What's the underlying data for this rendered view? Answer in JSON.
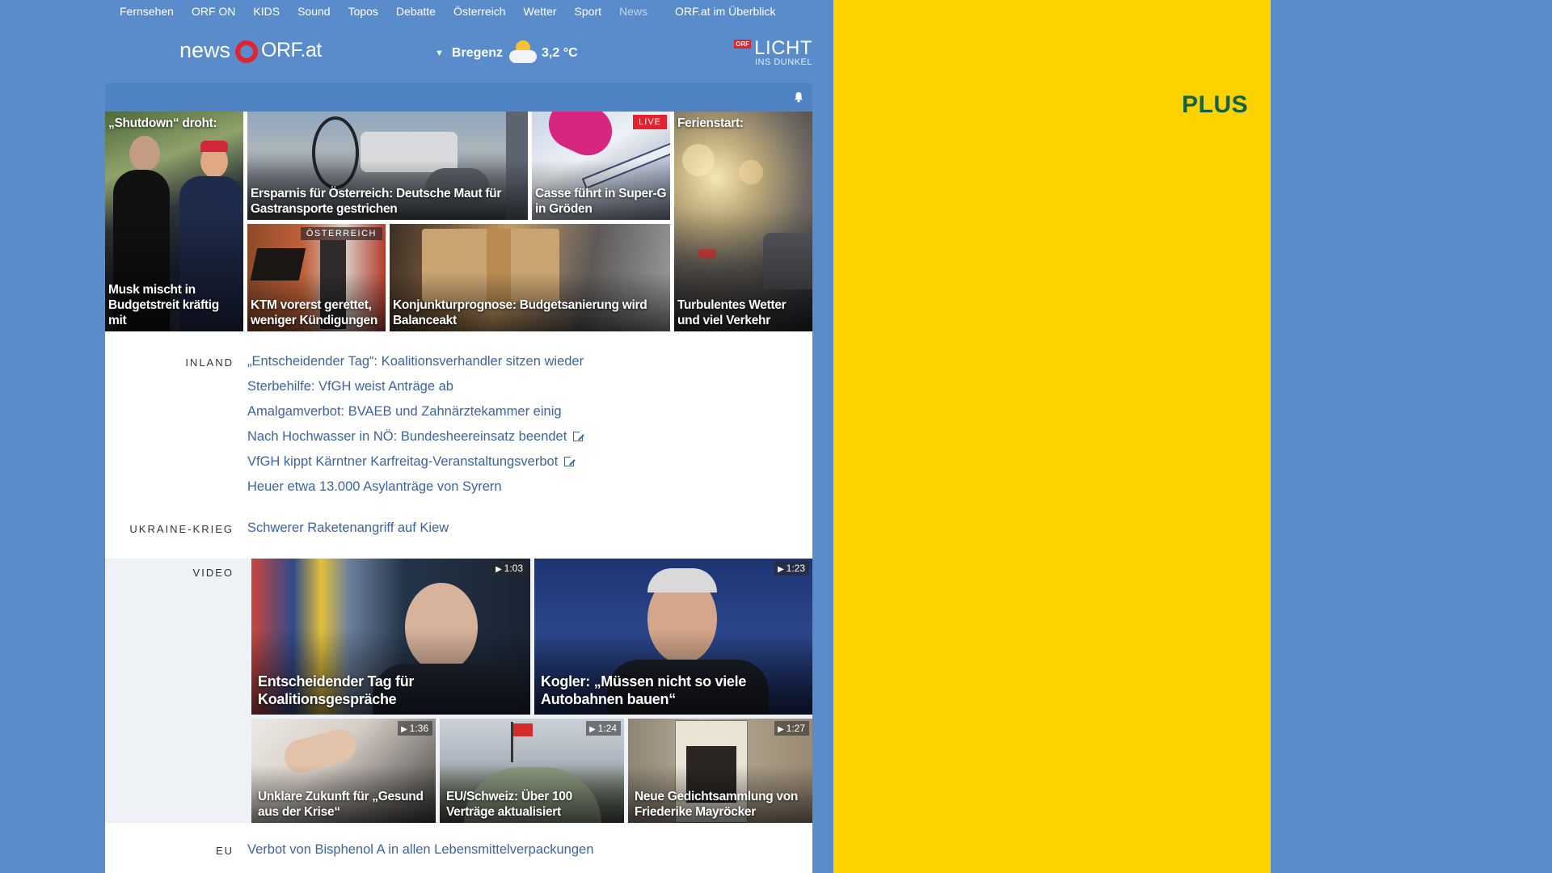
{
  "topnav": {
    "items": [
      "Fernsehen",
      "ORF ON",
      "KIDS",
      "Sound",
      "Topos",
      "Debatte",
      "Österreich",
      "Wetter",
      "Sport",
      "News"
    ],
    "overview": "ORF.at im Überblick"
  },
  "header": {
    "logo_news": "news",
    "logo_orf": "ORF.at",
    "weather_city": "Bregenz",
    "weather_temp": "3,2 °C",
    "licht_badge": "ORF",
    "licht_big": "LICHT",
    "licht_small": "INS DUNKEL"
  },
  "tiles": {
    "shutdown": {
      "top": "„Shutdown“ droht:",
      "caption": "Musk mischt in Budgetstreit kräftig mit"
    },
    "maut": {
      "caption": "Ersparnis für Österreich: Deutsche Maut für Gastransporte gestrichen"
    },
    "casse": {
      "badge": "LIVE",
      "caption": "Casse führt in Super-G in Gröden"
    },
    "ferien": {
      "top": "Ferienstart:",
      "caption": "Turbulentes Wetter und viel Verkehr"
    },
    "ktm": {
      "badge": "ÖSTERREICH",
      "caption": "KTM vorerst gerettet, weniger Kündigungen"
    },
    "konjunktur": {
      "caption": "Konjunkturprognose: Budgetsanierung wird Balanceakt"
    }
  },
  "inland": {
    "label": "INLAND",
    "links": [
      "„Entscheidender Tag“: Koalitionsverhandler sitzen wieder",
      "Sterbehilfe: VfGH weist Anträge ab",
      "Amalgamverbot: BVAEB und Zahnärztekammer einig",
      "Nach Hochwasser in NÖ: Bundesheereinsatz beendet",
      "VfGH kippt Kärntner Karfreitag-Veranstaltungsverbot",
      "Heuer etwa 13.000 Asylanträge von Syrern"
    ]
  },
  "ukraine": {
    "label": "UKRAINE-KRIEG",
    "link": "Schwerer Raketenangriff auf Kiew"
  },
  "video": {
    "label": "VIDEO",
    "items": [
      {
        "caption": "Entscheidender Tag für Koalitionsgespräche",
        "duration": "1:03"
      },
      {
        "caption": "Kogler: „Müssen nicht so viele Autobahnen bauen“",
        "duration": "1:23"
      },
      {
        "caption": "Unklare Zukunft für „Gesund aus der Krise“",
        "duration": "1:36"
      },
      {
        "caption": "EU/Schweiz: Über 100 Verträge aktualisiert",
        "duration": "1:24"
      },
      {
        "caption": "Neue Gedichtsammlung von Friederike Mayröcker",
        "duration": "1:27"
      }
    ]
  },
  "eu": {
    "label": "EU",
    "link": "Verbot von Bisphenol A in allen Lebensmittelverpackungen"
  },
  "ad": {
    "text": "PLUS",
    "color": "#fcd200"
  },
  "colors": {
    "brand_blue": "#5a8ccc",
    "link": "#3b64a0",
    "orf_red": "#e0232f"
  }
}
